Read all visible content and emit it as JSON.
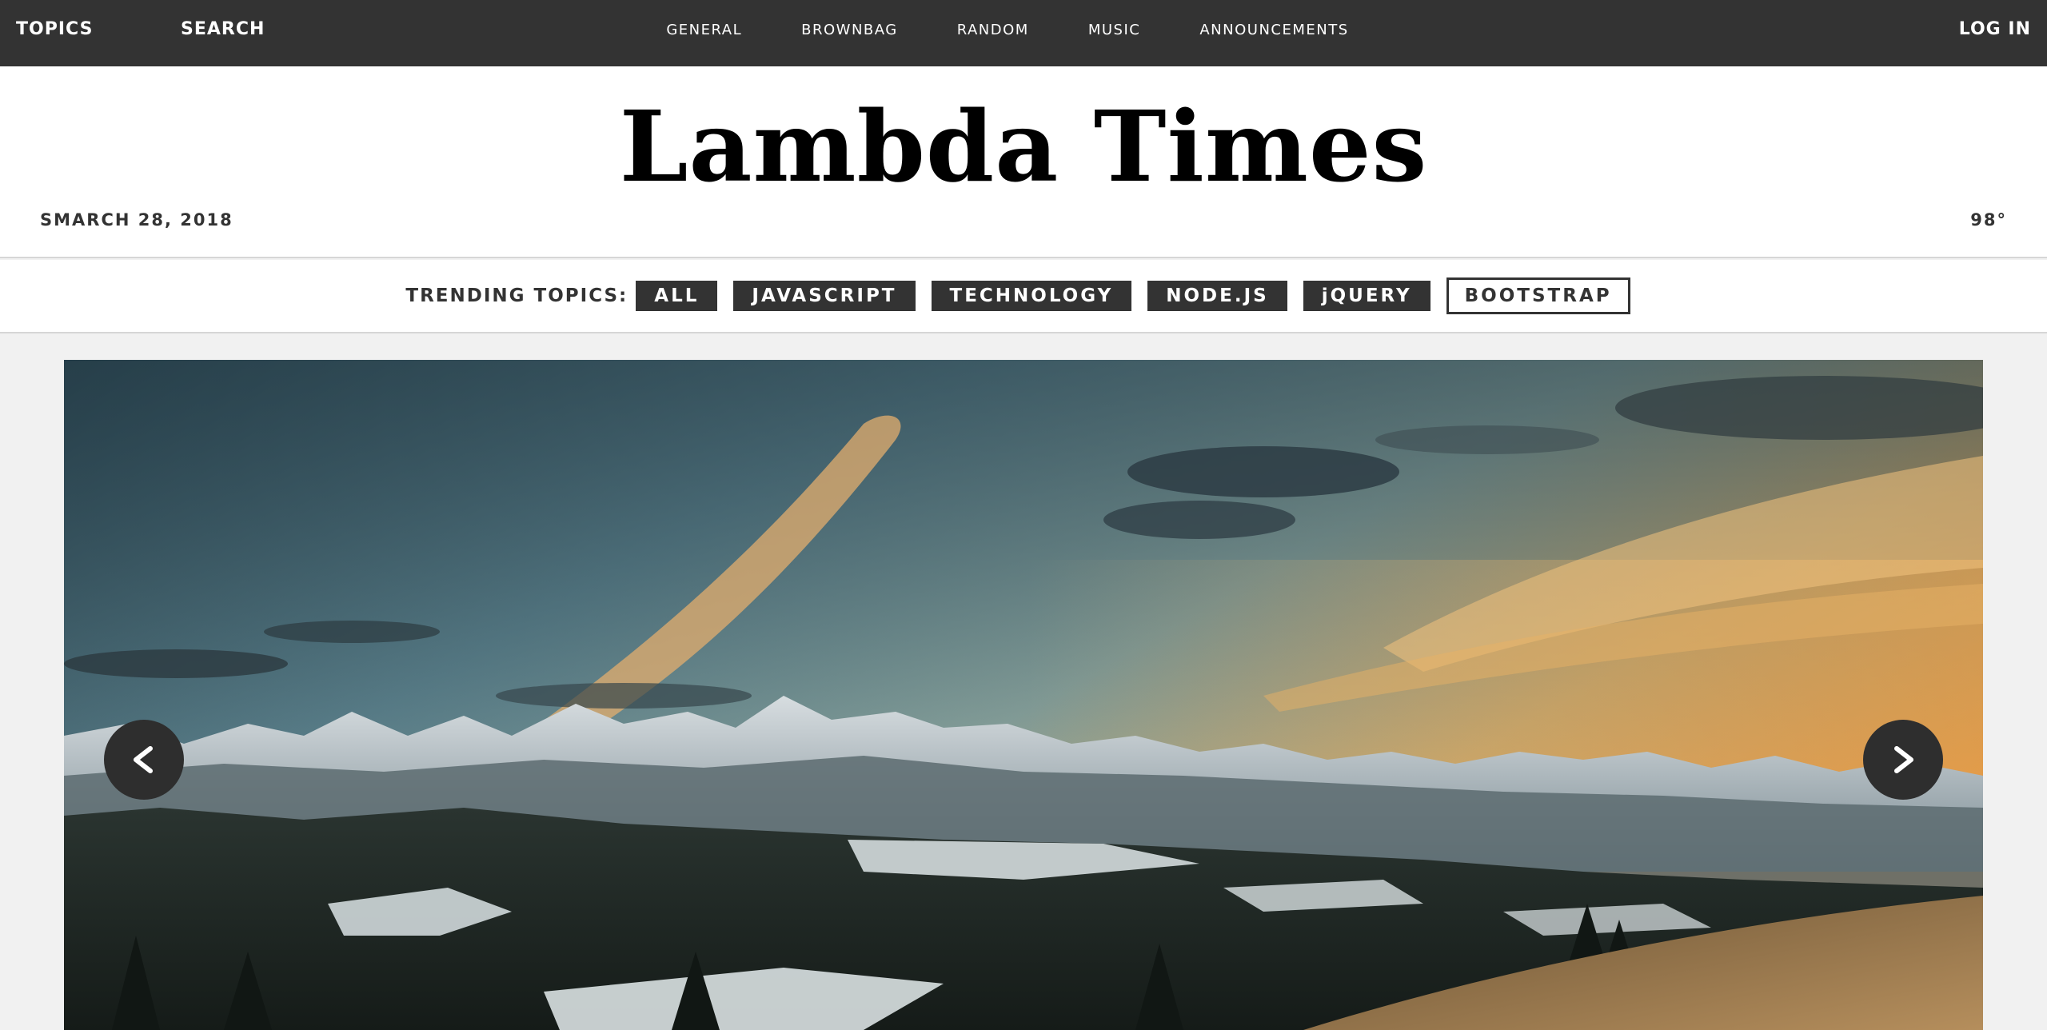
{
  "topbar": {
    "topics_label": "TOPICS",
    "search_label": "SEARCH",
    "nav": [
      "GENERAL",
      "BROWNBAG",
      "RANDOM",
      "MUSIC",
      "ANNOUNCEMENTS"
    ],
    "login_label": "LOG IN",
    "background_color": "#333333"
  },
  "header": {
    "title": "Lambda Times",
    "date": "SMARCH 28, 2018",
    "temperature": "98°"
  },
  "trending": {
    "label": "TRENDING TOPICS:",
    "tabs": [
      "ALL",
      "JAVASCRIPT",
      "TECHNOLOGY",
      "NODE.JS",
      "jQUERY",
      "BOOTSTRAP"
    ],
    "active_tab": "BOOTSTRAP"
  },
  "carousel": {
    "image": "mountain-landscape-sunset",
    "prev_icon": "chevron-left-icon",
    "next_icon": "chevron-right-icon"
  }
}
